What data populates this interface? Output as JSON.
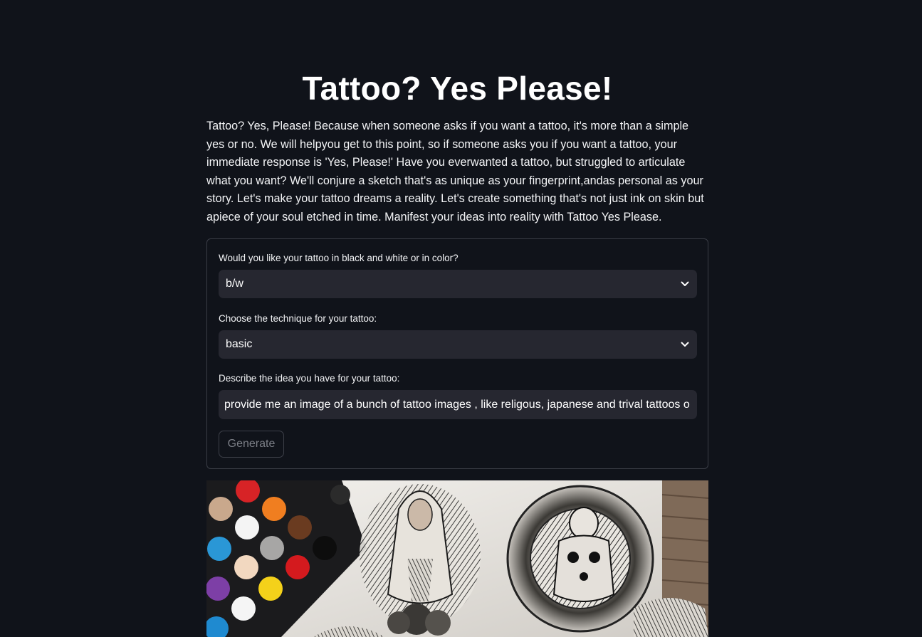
{
  "app": {
    "title": "Tattoo? Yes Please!",
    "intro": "Tattoo? Yes, Please! Because when someone asks if you want a tattoo, it's more than a simple yes or no. We will helpyou get to this point, so if someone asks you if you want a tattoo, your immediate response is 'Yes, Please!' Have you everwanted a tattoo, but struggled to articulate what you want? We'll conjure a sketch that's as unique as your fingerprint,andas personal as your story. Let's make your tattoo dreams a reality. Let's create something that's not just ink on skin but apiece of your soul etched in time. Manifest your ideas into reality with Tattoo Yes Please."
  },
  "form": {
    "color_label": "Would you like your tattoo in black and white or in color?",
    "color_value": "b/w",
    "technique_label": "Choose the technique for your tattoo:",
    "technique_value": "basic",
    "idea_label": "Describe the idea you have for your tattoo:",
    "idea_value": "provide me an image of a bunch of tattoo images , like religous, japanese and trival tattoos o",
    "generate_label": "Generate"
  },
  "icons": {
    "dropdown": "chevron-down-icon"
  },
  "result_image": {
    "description": "generated tattoo image"
  }
}
